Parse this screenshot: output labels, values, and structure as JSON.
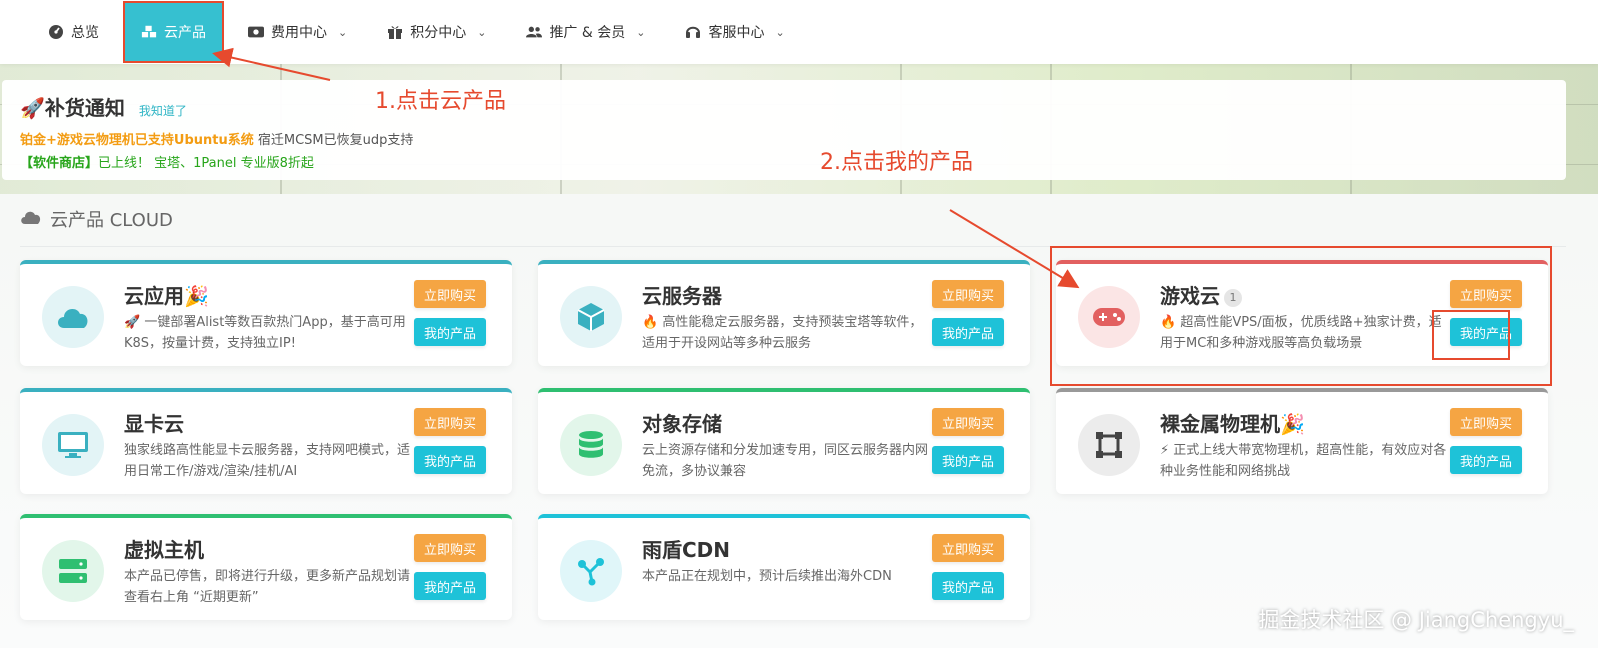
{
  "nav": {
    "items": [
      {
        "label": "总览",
        "icon": "dashboard-icon"
      },
      {
        "label": "云产品",
        "icon": "cubes-icon",
        "active": true
      },
      {
        "label": "费用中心",
        "icon": "money-icon",
        "dropdown": true
      },
      {
        "label": "积分中心",
        "icon": "gift-icon",
        "dropdown": true
      },
      {
        "label": "推广 & 会员",
        "icon": "users-icon",
        "dropdown": true
      },
      {
        "label": "客服中心",
        "icon": "headset-icon",
        "dropdown": true
      }
    ]
  },
  "notice": {
    "title": "补货通知",
    "ack": "我知道了",
    "line1_highlight": "铂金+游戏云物理机已支持Ubuntu系统",
    "line1_rest": " 宿迁MCSM已恢复udp支持",
    "line2_bracket": "【软件商店】",
    "line2_rest": "已上线！ 宝塔、1Panel 专业版8折起"
  },
  "annotations": {
    "step1": "1.点击云产品",
    "step2": "2.点击我的产品"
  },
  "section": {
    "title": "云产品 CLOUD"
  },
  "buttons": {
    "buy": "立即购买",
    "mine": "我的产品"
  },
  "cards": [
    {
      "title": "云应用",
      "title_suffix": "🎉",
      "desc": "🚀 一键部署Alist等数百款热门App，基于高可用K8S，按量计费，支持独立IP!",
      "icon": "cloud-icon",
      "color": "#3ab0c0"
    },
    {
      "title": "云服务器",
      "title_suffix": "",
      "desc": "🔥 高性能稳定云服务器，支持预装宝塔等软件，适用于开设网站等多种云服务",
      "icon": "cube-icon",
      "color": "#3ab0c0"
    },
    {
      "title": "游戏云",
      "title_suffix": "",
      "badge": "1",
      "desc": "🔥 超高性能VPS/面板，优质线路+独家计费，适用于MC和多种游戏服等高负载场景",
      "icon": "gamepad-icon",
      "color": "#e26060"
    },
    {
      "title": "显卡云",
      "title_suffix": "",
      "desc": "独家线路高性能显卡云服务器，支持网吧模式，适用日常工作/游戏/渲染/挂机/AI",
      "icon": "monitor-icon",
      "color": "#3ab0c0"
    },
    {
      "title": "对象存储",
      "title_suffix": "",
      "desc": "云上资源存储和分发加速专用，同区云服务器内网免流，多协议兼容",
      "icon": "database-icon",
      "color": "#2fbf71"
    },
    {
      "title": "裸金属物理机",
      "title_suffix": "🎉",
      "desc": "⚡ 正式上线大带宽物理机，超高性能，有效应对各种业务性能和网络挑战",
      "icon": "bare-metal-icon",
      "color": "#888888"
    },
    {
      "title": "虚拟主机",
      "title_suffix": "",
      "desc": "本产品已停售，即将进行升级，更多新产品规划请查看右上角 “近期更新”",
      "icon": "server-icon",
      "color": "#2fbf71"
    },
    {
      "title": "雨盾CDN",
      "title_suffix": "",
      "desc": "本产品正在规划中，预计后续推出海外CDN",
      "icon": "share-nodes-icon",
      "color": "#1ec2d8"
    }
  ],
  "watermark": "掘金技术社区 @ JiangChengyu_"
}
